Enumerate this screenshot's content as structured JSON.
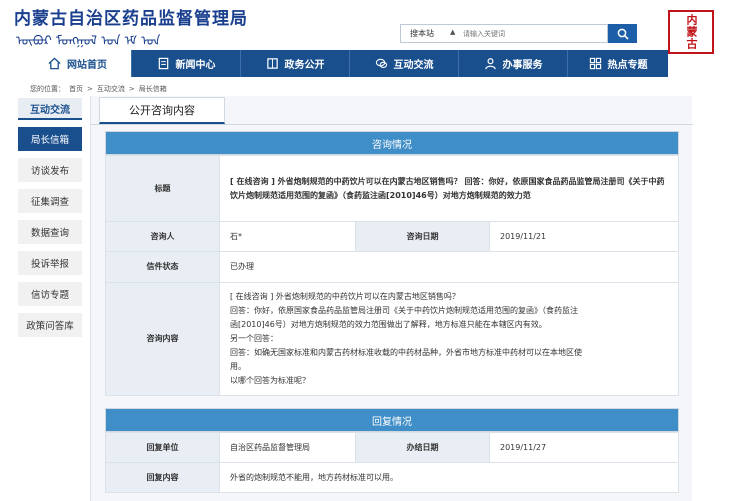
{
  "header": {
    "site_title": "内蒙古自治区药品监督管理局",
    "mongolian_title": "ᠥᠪᠥᠷ ᠮᠣᠩᠭᠣᠯ ᠤᠨ ᠡᠮ ᠤᠨ",
    "search_scope": "搜本站",
    "search_placeholder": "请输入关键词",
    "emblem_text": "内蒙古"
  },
  "nav": {
    "items": [
      {
        "label": "网站首页",
        "icon": "home-icon"
      },
      {
        "label": "新闻中心",
        "icon": "document-icon"
      },
      {
        "label": "政务公开",
        "icon": "folder-icon"
      },
      {
        "label": "互动交流",
        "icon": "chat-icon"
      },
      {
        "label": "办事服务",
        "icon": "person-icon"
      },
      {
        "label": "热点专题",
        "icon": "grid-icon"
      }
    ]
  },
  "breadcrumb": {
    "prefix": "您的位置：",
    "items": [
      "首页",
      "互动交流",
      "局长信箱"
    ],
    "separator": ">"
  },
  "sidebar": {
    "header": "互动交流",
    "items": [
      "局长信箱",
      "访谈发布",
      "征集调查",
      "数据查询",
      "投诉举报",
      "信访专题",
      "政策问答库"
    ]
  },
  "main": {
    "tab": "公开咨询内容",
    "consult": {
      "heading": "咨询情况",
      "title_label": "标题",
      "title_value": "[ 在线咨询 ] 外省炮制规范的中药饮片可以在内蒙古地区销售吗？ 回答：你好，依原国家食品药品监管局注册司《关于中药饮片炮制规范适用范围的复函》（食药监注函[2010]46号）对地方炮制规范的效力范",
      "person_label": "咨询人",
      "person_value": "石*",
      "date_label": "咨询日期",
      "date_value": "2019/11/21",
      "status_label": "信件状态",
      "status_value": "已办理",
      "content_label": "咨询内容",
      "content_lines": [
        "[ 在线咨询 ] 外省炮制规范的中药饮片可以在内蒙古地区销售吗？",
        "回答：你好，依原国家食品药品监管局注册司《关于中药饮片炮制规范适用范围的复函》（食药监注",
        "函[2010]46号）对地方炮制规范的效力范围做出了解释，地方标准只能在本辖区内有效。",
        "另一个回答：",
        "回答：如确无国家标准和内蒙古药材标准收载的中药材品种，外省市地方标准中药材可以在本地区使",
        "用。",
        "以哪个回答为标准呢？"
      ]
    },
    "reply": {
      "heading": "回复情况",
      "unit_label": "回复单位",
      "unit_value": "自治区药品监督管理局",
      "done_date_label": "办结日期",
      "done_date_value": "2019/11/27",
      "content_label": "回复内容",
      "content_value": "外省的炮制规范不能用，地方药材标准可以用。"
    }
  }
}
